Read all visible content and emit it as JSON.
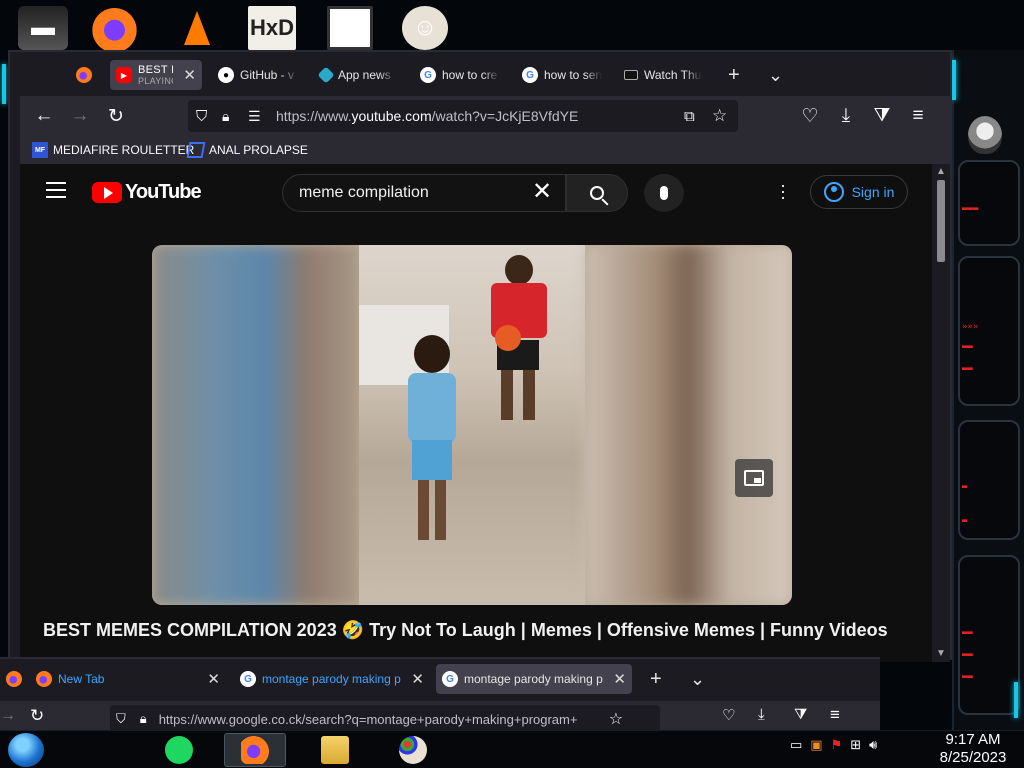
{
  "browser": {
    "tabs": [
      {
        "title": "BEST MEMES",
        "subtitle": "PLAYING",
        "active": true
      },
      {
        "title": "GitHub - v"
      },
      {
        "title": "App news"
      },
      {
        "title": "how to cre"
      },
      {
        "title": "how to sen"
      },
      {
        "title": "Watch Thu"
      }
    ],
    "new_tab": "+",
    "list_tabs": "⌄",
    "close": "✕",
    "url_prefix": "https://www.",
    "url_domain": "youtube.com",
    "url_path": "/watch?v=JcKjE8VfdYE",
    "bookmarks": [
      {
        "label": "MEDIAFIRE ROULETTER",
        "icon_text": "MF"
      },
      {
        "label": "ANAL PROLAPSE"
      }
    ]
  },
  "youtube": {
    "logo_text": "YouTube",
    "search_value": "meme compilation",
    "sign_in": "Sign in",
    "video_title": "BEST MEMES COMPILATION 2023 🤣 Try Not To Laugh | Memes | Offensive Memes | Funny Videos"
  },
  "second_window": {
    "tabs": [
      {
        "title": "New Tab"
      },
      {
        "title": "montage parody making p"
      },
      {
        "title": "montage parody making p",
        "active": true
      }
    ],
    "url": "https://www.google.co.ck/search?q=montage+parody+making+program+"
  },
  "taskbar": {
    "time": "9:17 AM",
    "date": "8/25/2023"
  },
  "colors": {
    "accent_cyan": "#16c8e8",
    "youtube_red": "#ff0000",
    "signin_blue": "#3ea6ff",
    "firefox_dark": "#1c1b22"
  }
}
